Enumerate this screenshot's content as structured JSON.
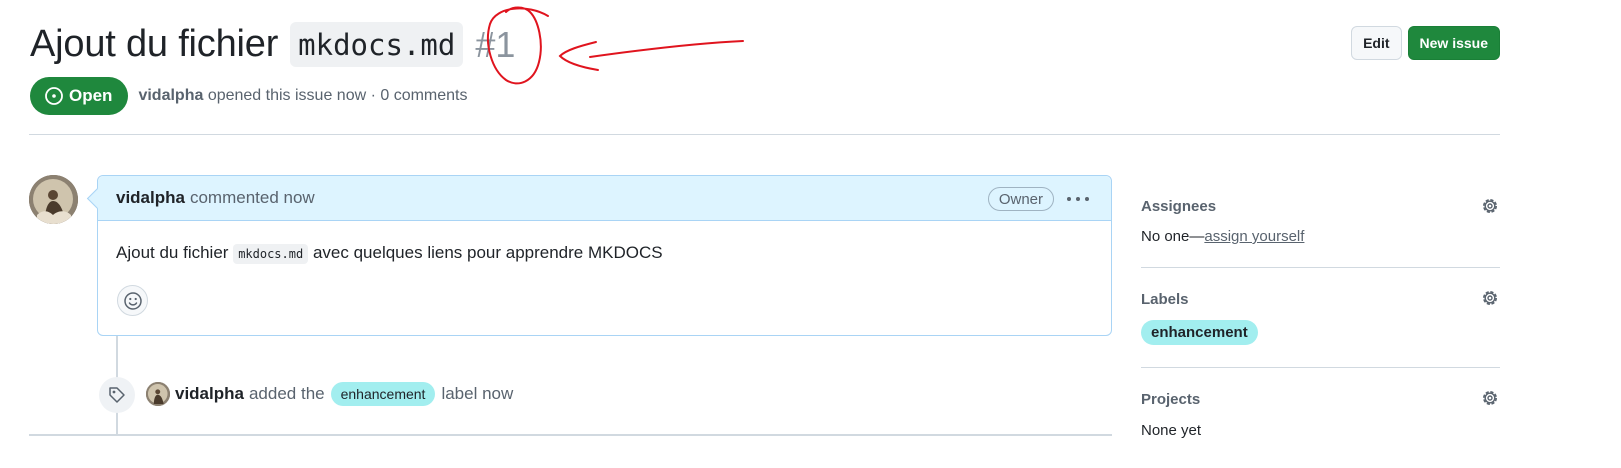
{
  "header": {
    "title_text": "Ajout du fichier",
    "title_code": "mkdocs.md",
    "issue_number": "#1",
    "edit_label": "Edit",
    "new_issue_label": "New issue"
  },
  "state": {
    "label": "Open",
    "color": "#1f883d",
    "author": "vidalpha",
    "meta": "opened this issue now · 0 comments"
  },
  "comment": {
    "author": "vidalpha",
    "time": "commented now",
    "badge": "Owner",
    "body_before": "Ajout du fichier",
    "body_code": "mkdocs.md",
    "body_after": "avec quelques liens pour apprendre MKDOCS",
    "header_bg": "#ddf4ff",
    "border_color": "#a9d4f5"
  },
  "event": {
    "author": "vidalpha",
    "action": "added the",
    "label": "enhancement",
    "suffix": "label now",
    "label_color": "#a2eeef"
  },
  "sidebar": {
    "assignees": {
      "heading": "Assignees",
      "value": "No one—",
      "link": "assign yourself"
    },
    "labels": {
      "heading": "Labels",
      "label": "enhancement"
    },
    "projects": {
      "heading": "Projects",
      "value": "None yet"
    }
  },
  "icons": [
    "issue-open-icon",
    "kebab-icon",
    "smiley-icon",
    "tag-icon",
    "gear-icon"
  ],
  "annotation_color": "#e0141e"
}
